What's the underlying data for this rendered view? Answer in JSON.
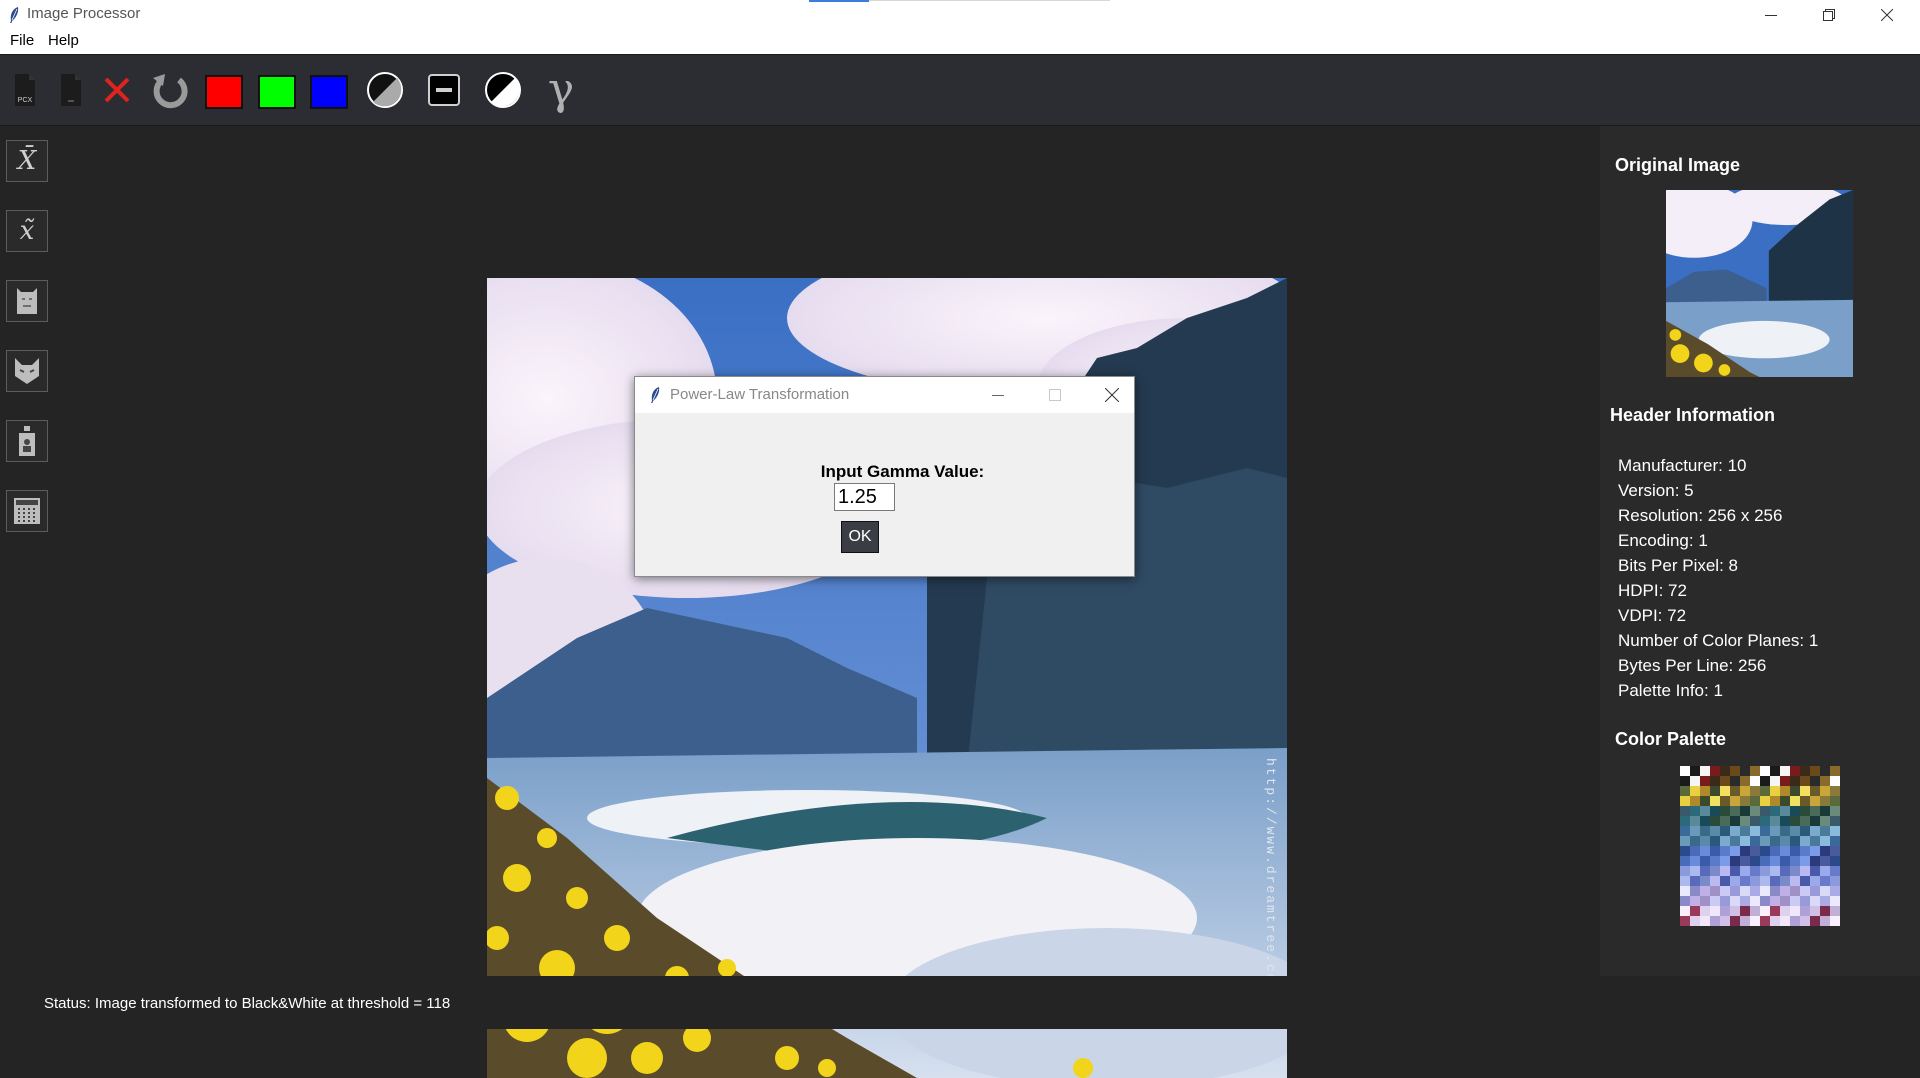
{
  "window": {
    "title": "Image Processor",
    "controls": [
      "minimize",
      "restore",
      "close"
    ]
  },
  "menu": {
    "items": [
      "File",
      "Help"
    ]
  },
  "toolbar": {
    "buttons": [
      {
        "name": "open-pcx-icon",
        "label": "PCX"
      },
      {
        "name": "open-file-icon",
        "label": ""
      },
      {
        "name": "close-image-icon",
        "label": ""
      },
      {
        "name": "reset-icon",
        "label": ""
      },
      {
        "name": "red-channel-button",
        "color": "#ff0000"
      },
      {
        "name": "green-channel-button",
        "color": "#00ff00"
      },
      {
        "name": "blue-channel-button",
        "color": "#0000ff"
      },
      {
        "name": "grayscale-icon",
        "label": ""
      },
      {
        "name": "negative-icon",
        "label": ""
      },
      {
        "name": "black-white-icon",
        "label": ""
      },
      {
        "name": "gamma-icon",
        "label": "γ"
      }
    ]
  },
  "sidebar": {
    "tools": [
      {
        "name": "mean-filter-icon",
        "symbol": "X̄"
      },
      {
        "name": "median-filter-icon",
        "symbol": "x̃"
      },
      {
        "name": "cat-filter-icon",
        "symbol": ""
      },
      {
        "name": "cat-face-filter-icon",
        "symbol": ""
      },
      {
        "name": "bottle-filter-icon",
        "symbol": ""
      },
      {
        "name": "grid-filter-icon",
        "symbol": ""
      }
    ]
  },
  "right_panel": {
    "original_title": "Original Image",
    "header_title": "Header Information",
    "header_lines": [
      "Manufacturer: 10",
      "Version: 5",
      "Resolution: 256 x 256",
      "Encoding: 1",
      "Bits Per Pixel: 8",
      "HDPI: 72",
      "VDPI: 72",
      "Number of Color Planes: 1",
      "Bytes Per Line: 256",
      "Palette Info: 1"
    ],
    "palette_title": "Color Palette"
  },
  "dialog": {
    "title": "Power-Law Transformation",
    "label": "Input Gamma Value:",
    "value": "1.25",
    "ok": "OK"
  },
  "status": {
    "text": "Status: Image transformed to Black&White at threshold = 118"
  },
  "colors": {
    "toolbar_bg": "#2b2d33",
    "panel_bg": "#2a2a2a",
    "canvas_bg": "#242424"
  }
}
